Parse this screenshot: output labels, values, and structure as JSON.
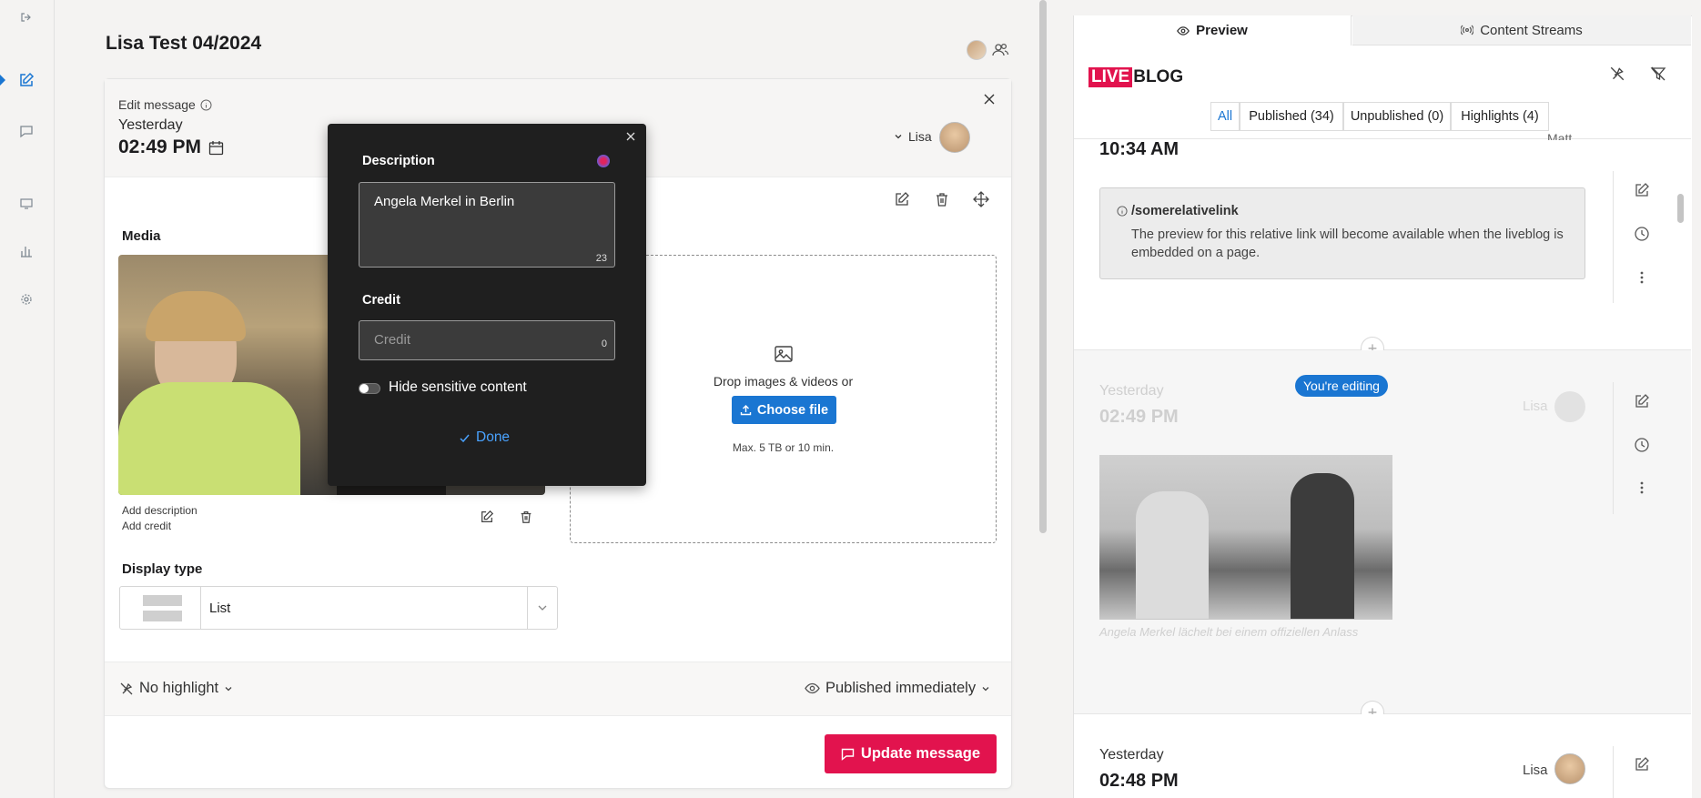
{
  "document": {
    "title": "Lisa Test 04/2024"
  },
  "editor": {
    "edit_label": "Edit message",
    "date_label": "Yesterday",
    "time": "02:49 PM",
    "author": "Lisa",
    "media_label": "Media",
    "add_description": "Add description",
    "add_credit": "Add credit",
    "drop_text": "Drop images & videos or",
    "choose_file": "Choose file",
    "max_text": "Max. 5 TB or 10 min.",
    "display_type_label": "Display type",
    "display_type_value": "List",
    "highlight": "No highlight",
    "publish_status": "Published immediately",
    "update_button": "Update message"
  },
  "popover": {
    "description_label": "Description",
    "description_value": "Angela Merkel in Berlin",
    "description_count": "23",
    "credit_label": "Credit",
    "credit_placeholder": "Credit",
    "credit_count": "0",
    "sensitive_label": "Hide sensitive content",
    "sensitive_on": false,
    "done_label": "Done"
  },
  "preview": {
    "tabs": [
      {
        "label": "Preview",
        "active": true
      },
      {
        "label": "Content Streams",
        "active": false
      }
    ],
    "logo_live": "LIVE",
    "logo_blog": "BLOG",
    "filters": [
      "All",
      "Published (34)",
      "Unpublished (0)",
      "Highlights (4)"
    ],
    "active_filter": "All",
    "post1": {
      "time": "10:34 AM",
      "author_partial": "Matt",
      "link_title": "/somerelativelink",
      "link_note": "The preview for this relative link will become available when the liveblog is embedded on a page."
    },
    "editing_badge": "You're editing",
    "post2": {
      "date": "Yesterday",
      "time": "02:49 PM",
      "author": "Lisa",
      "caption": "Angela Merkel lächelt bei einem offiziellen Anlass"
    },
    "post3": {
      "date": "Yesterday",
      "time": "02:48 PM",
      "author": "Lisa"
    }
  },
  "colors": {
    "accent": "#1a76d2",
    "update_red": "#e2134e",
    "logo_red": "#e2134e"
  }
}
